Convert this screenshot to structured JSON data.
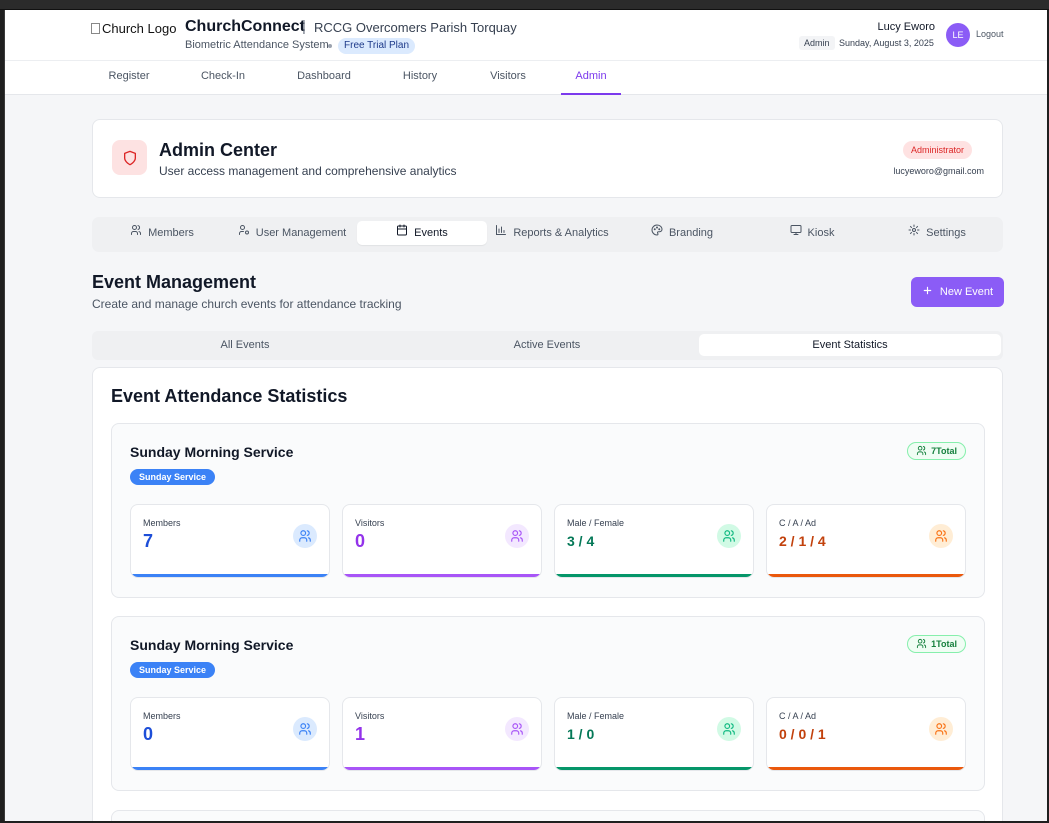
{
  "header": {
    "logo_alt": "Church Logo",
    "app_name": "ChurchConnect",
    "separator": "|",
    "parish": "RCCG Overcomers Parish Torquay",
    "subtitle": "Biometric Attendance System",
    "plan": "Free Trial Plan",
    "user_name": "Lucy Eworo",
    "role": "Admin",
    "date": "Sunday, August 3, 2025",
    "avatar_initials": "LE",
    "logout": "Logout"
  },
  "nav": {
    "tabs": [
      {
        "label": "Register"
      },
      {
        "label": "Check-In"
      },
      {
        "label": "Dashboard"
      },
      {
        "label": "History"
      },
      {
        "label": "Visitors"
      },
      {
        "label": "Admin"
      }
    ],
    "active": "Admin"
  },
  "admin": {
    "title": "Admin Center",
    "description": "User access management and comprehensive analytics",
    "badge": "Administrator",
    "email": "lucyeworo@gmail.com"
  },
  "admin_tabs": [
    {
      "label": "Members",
      "icon": "users-icon"
    },
    {
      "label": "User Management",
      "icon": "user-cog-icon"
    },
    {
      "label": "Events",
      "icon": "calendar-icon"
    },
    {
      "label": "Reports & Analytics",
      "icon": "bar-chart-icon"
    },
    {
      "label": "Branding",
      "icon": "palette-icon"
    },
    {
      "label": "Kiosk",
      "icon": "monitor-icon"
    },
    {
      "label": "Settings",
      "icon": "gear-icon"
    }
  ],
  "event_management": {
    "title": "Event Management",
    "description": "Create and manage church events for attendance tracking",
    "new_button": "New Event",
    "tabs": [
      {
        "label": "All Events"
      },
      {
        "label": "Active Events"
      },
      {
        "label": "Event Statistics"
      }
    ],
    "active_tab": "Event Statistics"
  },
  "stats": {
    "title": "Event Attendance Statistics",
    "events": [
      {
        "name": "Sunday Morning Service",
        "type": "Sunday Service",
        "total": "7Total",
        "members_label": "Members",
        "members": "7",
        "visitors_label": "Visitors",
        "visitors": "0",
        "gender_label": "Male / Female",
        "gender": "3 / 4",
        "age_label": "C / A / Ad",
        "age": "2 / 1 / 4"
      },
      {
        "name": "Sunday Morning Service",
        "type": "Sunday Service",
        "total": "1Total",
        "members_label": "Members",
        "members": "0",
        "visitors_label": "Visitors",
        "visitors": "1",
        "gender_label": "Male / Female",
        "gender": "1 / 0",
        "age_label": "C / A / Ad",
        "age": "0 / 0 / 1"
      }
    ]
  },
  "colors": {
    "accent": "#8b5cf6",
    "members": "#3b82f6",
    "visitors": "#a855f7",
    "gender": "#10b981",
    "age": "#f97316"
  }
}
